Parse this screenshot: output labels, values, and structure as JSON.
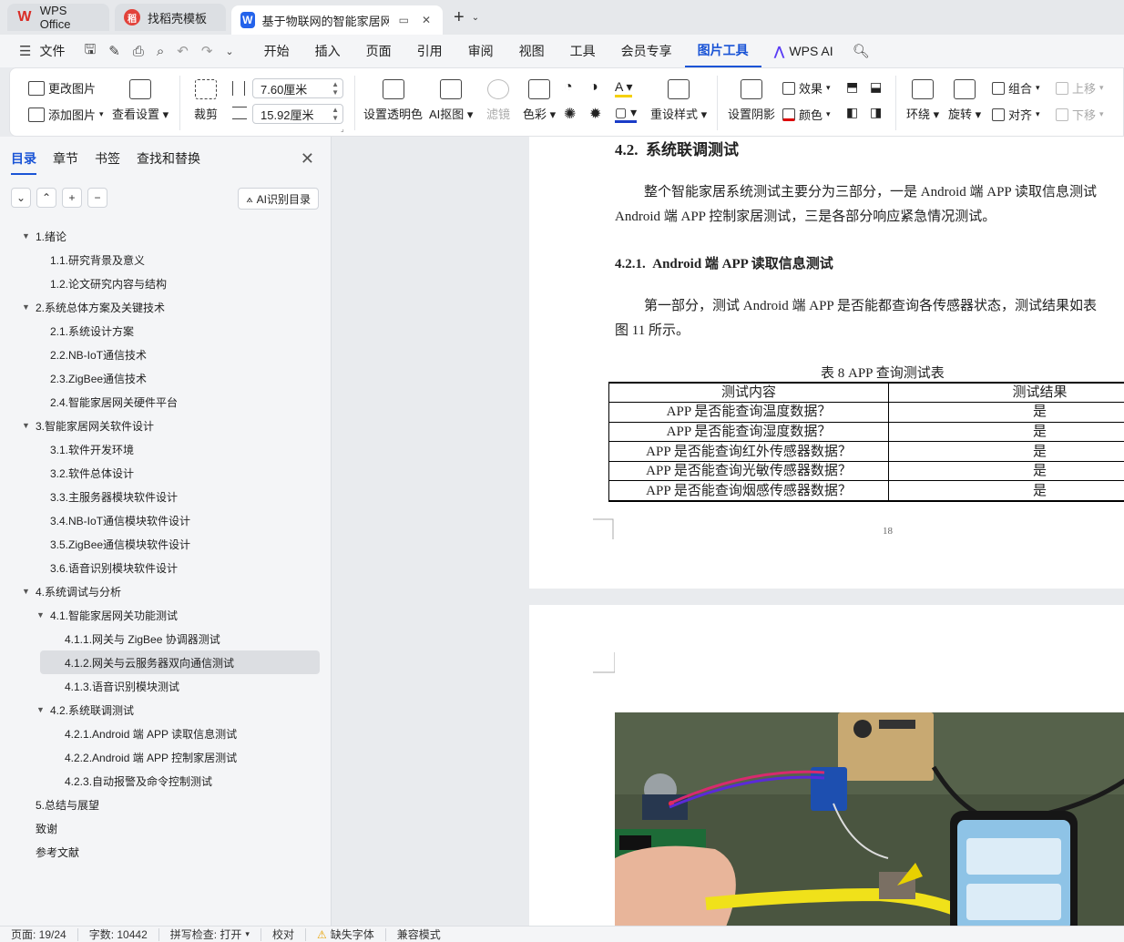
{
  "tabs": [
    {
      "label": "WPS Office",
      "logo": "W",
      "color": "#d92d27"
    },
    {
      "label": "找稻壳模板",
      "logo": "稻",
      "color": "#e2423a"
    },
    {
      "label": "基于物联网的智能家居网关设",
      "logo": "W",
      "color": "#2463eb"
    }
  ],
  "menu": {
    "file": "文件",
    "items": [
      "开始",
      "插入",
      "页面",
      "引用",
      "审阅",
      "视图",
      "工具",
      "会员专享",
      "图片工具",
      "WPS AI"
    ],
    "active": "图片工具"
  },
  "ribbon": {
    "change_image": "更改图片",
    "add_image": "添加图片",
    "view_settings": "查看设置",
    "crop": "裁剪",
    "width_value": "7.60厘米",
    "height_value": "15.92厘米",
    "set_transparent": "设置透明色",
    "ai_cutout": "AI抠图",
    "filter": "滤镜",
    "color": "色彩",
    "reset_style": "重设样式",
    "set_shadow": "设置阴影",
    "effect": "效果",
    "color2": "颜色",
    "wrap": "环绕",
    "rotate": "旋转",
    "group": "组合",
    "align": "对齐",
    "move_up": "上移",
    "move_down": "下移"
  },
  "nav": {
    "tabs": [
      "目录",
      "章节",
      "书签",
      "查找和替换"
    ],
    "ai_toc": "AI识别目录",
    "toc": [
      {
        "label": "1.绪论",
        "level": 1,
        "expanded": true
      },
      {
        "label": "1.1.研究背景及意义",
        "level": 2
      },
      {
        "label": "1.2.论文研究内容与结构",
        "level": 2
      },
      {
        "label": "2.系统总体方案及关键技术",
        "level": 1,
        "expanded": true
      },
      {
        "label": "2.1.系统设计方案",
        "level": 2
      },
      {
        "label": "2.2.NB-IoT通信技术",
        "level": 2
      },
      {
        "label": "2.3.ZigBee通信技术",
        "level": 2
      },
      {
        "label": "2.4.智能家居网关硬件平台",
        "level": 2
      },
      {
        "label": "3.智能家居网关软件设计",
        "level": 1,
        "expanded": true
      },
      {
        "label": "3.1.软件开发环境",
        "level": 2
      },
      {
        "label": "3.2.软件总体设计",
        "level": 2
      },
      {
        "label": "3.3.主服务器模块软件设计",
        "level": 2
      },
      {
        "label": "3.4.NB-IoT通信模块软件设计",
        "level": 2
      },
      {
        "label": "3.5.ZigBee通信模块软件设计",
        "level": 2
      },
      {
        "label": "3.6.语音识别模块软件设计",
        "level": 2
      },
      {
        "label": "4.系统调试与分析",
        "level": 1,
        "expanded": true
      },
      {
        "label": "4.1.智能家居网关功能测试",
        "level": 2,
        "expanded": true
      },
      {
        "label": "4.1.1.网关与 ZigBee 协调器测试",
        "level": 3
      },
      {
        "label": "4.1.2.网关与云服务器双向通信测试",
        "level": 3,
        "selected": true
      },
      {
        "label": "4.1.3.语音识别模块测试",
        "level": 3
      },
      {
        "label": "4.2.系统联调测试",
        "level": 2,
        "expanded": true
      },
      {
        "label": "4.2.1.Android 端 APP 读取信息测试",
        "level": 3
      },
      {
        "label": "4.2.2.Android 端 APP 控制家居测试",
        "level": 3
      },
      {
        "label": "4.2.3.自动报警及命令控制测试",
        "level": 3
      },
      {
        "label": "5.总结与展望",
        "level": 1
      },
      {
        "label": "致谢",
        "level": 1
      },
      {
        "label": "参考文献",
        "level": 1
      }
    ]
  },
  "doc": {
    "heading_num": "4.2.",
    "heading_text": "系统联调测试",
    "para1_line1": "整个智能家居系统测试主要分为三部分，一是 Android 端 APP 读取信息测试",
    "para1_line2": "Android 端 APP 控制家居测试，三是各部分响应紧急情况测试。",
    "subheading_num": "4.2.1.",
    "subheading_text": "Android 端 APP 读取信息测试",
    "para2_line1": "第一部分，测试 Android 端 APP 是否能都查询各传感器状态，测试结果如表",
    "para2_line2": "图 11 所示。",
    "table_caption": "表  8 APP 查询测试表",
    "table_headers": [
      "测试内容",
      "测试结果"
    ],
    "table_rows": [
      [
        "APP 是否能查询温度数据？",
        "是"
      ],
      [
        "APP 是否能查询湿度数据？",
        "是"
      ],
      [
        "APP 是否能查询红外传感器数据？",
        "是"
      ],
      [
        "APP 是否能查询光敏传感器数据？",
        "是"
      ],
      [
        "APP 是否能查询烟感传感器数据？",
        "是"
      ]
    ],
    "page_number": "18"
  },
  "status": {
    "page": "页面: 19/24",
    "words": "字数: 10442",
    "spell": "拼写检查: 打开",
    "proof": "校对",
    "missing_font": "缺失字体",
    "compat": "兼容模式"
  }
}
